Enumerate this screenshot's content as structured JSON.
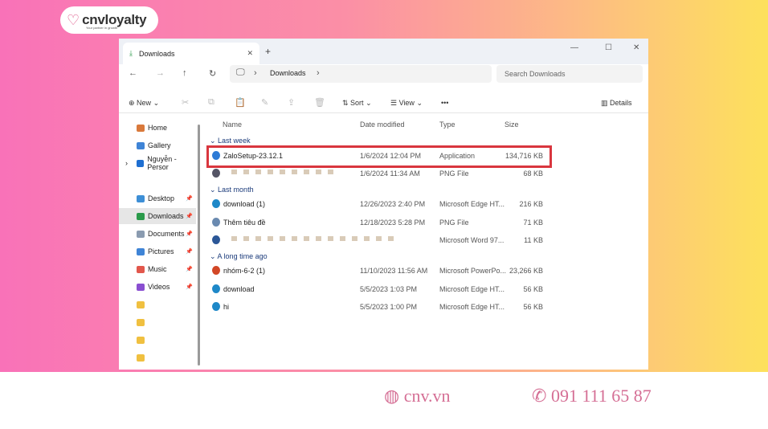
{
  "brand": {
    "logo": "cnvloyalty",
    "tagline": "Your partner in growth",
    "website": "cnv.vn",
    "phone": "091 111 65 87",
    "accent": "#e0608f"
  },
  "window": {
    "tab_title": "Downloads",
    "new_tab": "+",
    "minimize": "—",
    "maximize": "☐",
    "close": "✕"
  },
  "address": {
    "back": "←",
    "forward": "→",
    "up": "↑",
    "refresh": "↻",
    "path": "Downloads",
    "chevron": "›",
    "search_placeholder": "Search Downloads"
  },
  "toolbar": {
    "new": "New",
    "sort": "Sort",
    "view": "View",
    "more": "•••",
    "details": "Details"
  },
  "sidebar": [
    {
      "label": "Home",
      "color": "#d9793b"
    },
    {
      "label": "Gallery",
      "color": "#3f84d6"
    },
    {
      "label": "Nguyễn - Persor",
      "color": "#1f6fd1"
    },
    {
      "label": "Desktop",
      "color": "#3d8fd6"
    },
    {
      "label": "Downloads",
      "color": "#2a9a4a"
    },
    {
      "label": "Documents",
      "color": "#8a9bb0"
    },
    {
      "label": "Pictures",
      "color": "#3f84d6"
    },
    {
      "label": "Music",
      "color": "#e2574c"
    },
    {
      "label": "Videos",
      "color": "#8a4fd1"
    }
  ],
  "columns": [
    "Name",
    "Date modified",
    "Type",
    "Size"
  ],
  "groups": [
    "Last week",
    "Last month",
    "A long time ago"
  ],
  "files": [
    {
      "name": "ZaloSetup-23.12.1",
      "date": "1/6/2024 12:04 PM",
      "type": "Application",
      "size": "134,716 KB",
      "icon": "#2d7bd6"
    },
    {
      "name": "",
      "date": "1/6/2024 11:34 AM",
      "type": "PNG File",
      "size": "68 KB",
      "icon": "#556"
    },
    {
      "name": "download (1)",
      "date": "12/26/2023 2:40 PM",
      "type": "Microsoft Edge HT...",
      "size": "216 KB",
      "icon": "#1e88c8"
    },
    {
      "name": "Thêm tiêu đề",
      "date": "12/18/2023 5:28 PM",
      "type": "PNG File",
      "size": "71 KB",
      "icon": "#6a8ab0"
    },
    {
      "name": "",
      "date": "",
      "type": "Microsoft Word 97...",
      "size": "11 KB",
      "icon": "#2b5797"
    },
    {
      "name": "nhóm-6-2 (1)",
      "date": "11/10/2023 11:56 AM",
      "type": "Microsoft PowerPo...",
      "size": "23,266 KB",
      "icon": "#d24726"
    },
    {
      "name": "download",
      "date": "5/5/2023 1:03 PM",
      "type": "Microsoft Edge HT...",
      "size": "56 KB",
      "icon": "#1e88c8"
    },
    {
      "name": "hi",
      "date": "5/5/2023 1:00 PM",
      "type": "Microsoft Edge HT...",
      "size": "56 KB",
      "icon": "#1e88c8"
    }
  ]
}
